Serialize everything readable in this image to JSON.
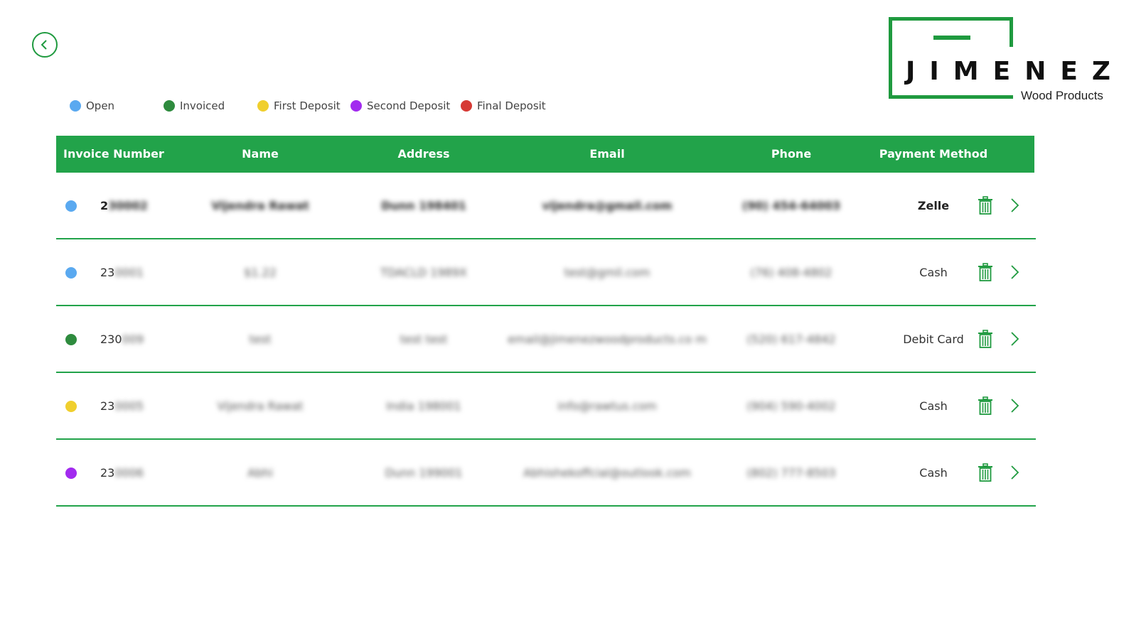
{
  "logo": {
    "name": "JIMENEZ",
    "subtitle": "Wood Products"
  },
  "legend": [
    {
      "label": "Open",
      "color": "#5aa9f0"
    },
    {
      "label": "Invoiced",
      "color": "#2e8b3e"
    },
    {
      "label": "First Deposit",
      "color": "#f0cf2e"
    },
    {
      "label": "Second Deposit",
      "color": "#a22bef"
    },
    {
      "label": "Final Deposit",
      "color": "#d63a35"
    }
  ],
  "table": {
    "headers": {
      "invoice": "Invoice Number",
      "name": "Name",
      "address": "Address",
      "email": "Email",
      "phone": "Phone",
      "payment": "Payment Method"
    },
    "rows": [
      {
        "status_color": "#5aa9f0",
        "invoice_prefix": "2",
        "invoice_hidden": "30002",
        "name": "Vijendra Rawat",
        "address": "Dunn 198401",
        "email": "vijendra@gmail.com",
        "phone": "(90) 454-64003",
        "payment": "Zelle",
        "bold": true
      },
      {
        "status_color": "#5aa9f0",
        "invoice_prefix": "23",
        "invoice_hidden": "0001",
        "name": "$1.22",
        "address": "TDACLD 1989X",
        "email": "test@gmil.com",
        "phone": "(76) 408-4802",
        "payment": "Cash",
        "bold": false
      },
      {
        "status_color": "#2e8b3e",
        "invoice_prefix": "230",
        "invoice_hidden": "009",
        "name": "test",
        "address": "test test",
        "email": "email@jimenezwoodproducts.co m",
        "phone": "(520) 617-4842",
        "payment": "Debit Card",
        "bold": false
      },
      {
        "status_color": "#f0cf2e",
        "invoice_prefix": "23",
        "invoice_hidden": "0005",
        "name": "Vijendra Rawat",
        "address": "India 198001",
        "email": "info@rawtus.com",
        "phone": "(904) 590-4002",
        "payment": "Cash",
        "bold": false
      },
      {
        "status_color": "#a22bef",
        "invoice_prefix": "23",
        "invoice_hidden": "0006",
        "name": "Abhi",
        "address": "Dunn 199001",
        "email": "Abhishekoffcial@outlook.com",
        "phone": "(802) 777-8503",
        "payment": "Cash",
        "bold": false
      }
    ]
  },
  "colors": {
    "accent": "#22a34a",
    "icon": "#1f9a3f"
  },
  "icons": {
    "back": "chevron-left-circle-icon",
    "delete": "trash-icon",
    "open": "chevron-right-icon"
  }
}
